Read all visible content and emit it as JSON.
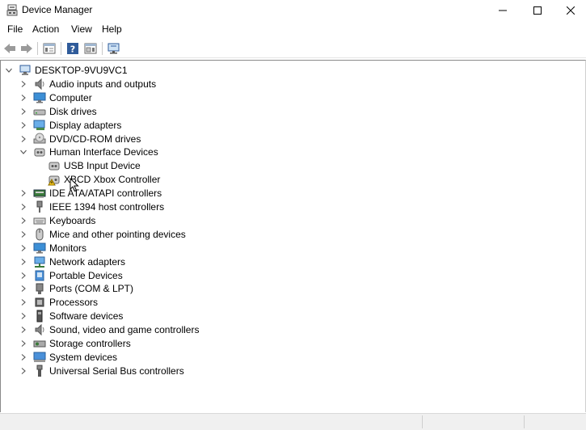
{
  "window": {
    "title": "Device Manager"
  },
  "menu": [
    "File",
    "Action",
    "View",
    "Help"
  ],
  "toolbar_icons": [
    "back-icon",
    "forward-icon",
    "properties-icon",
    "help-icon",
    "action-pane-icon",
    "monitor-scan-icon"
  ],
  "tree": {
    "root": "DESKTOP-9VU9VC1",
    "categories": [
      {
        "label": "Audio inputs and outputs",
        "icon": "speaker-icon"
      },
      {
        "label": "Computer",
        "icon": "computer-icon"
      },
      {
        "label": "Disk drives",
        "icon": "disk-drive-icon"
      },
      {
        "label": "Display adapters",
        "icon": "display-adapter-icon"
      },
      {
        "label": "DVD/CD-ROM drives",
        "icon": "dvd-drive-icon"
      },
      {
        "label": "Human Interface Devices",
        "icon": "hid-icon",
        "expanded": true,
        "children": [
          {
            "label": "USB Input Device",
            "icon": "hid-device-icon"
          },
          {
            "label": "XBCD Xbox Controller",
            "icon": "hid-warning-icon"
          }
        ]
      },
      {
        "label": "IDE ATA/ATAPI controllers",
        "icon": "ide-controller-icon"
      },
      {
        "label": "IEEE 1394 host controllers",
        "icon": "ieee1394-icon"
      },
      {
        "label": "Keyboards",
        "icon": "keyboard-icon"
      },
      {
        "label": "Mice and other pointing devices",
        "icon": "mouse-icon"
      },
      {
        "label": "Monitors",
        "icon": "monitor-icon"
      },
      {
        "label": "Network adapters",
        "icon": "network-adapter-icon"
      },
      {
        "label": "Portable Devices",
        "icon": "portable-device-icon"
      },
      {
        "label": "Ports (COM & LPT)",
        "icon": "port-icon"
      },
      {
        "label": "Processors",
        "icon": "processor-icon"
      },
      {
        "label": "Software devices",
        "icon": "software-device-icon"
      },
      {
        "label": "Sound, video and game controllers",
        "icon": "sound-controller-icon"
      },
      {
        "label": "Storage controllers",
        "icon": "storage-controller-icon"
      },
      {
        "label": "System devices",
        "icon": "system-device-icon"
      },
      {
        "label": "Universal Serial Bus controllers",
        "icon": "usb-controller-icon"
      }
    ]
  }
}
